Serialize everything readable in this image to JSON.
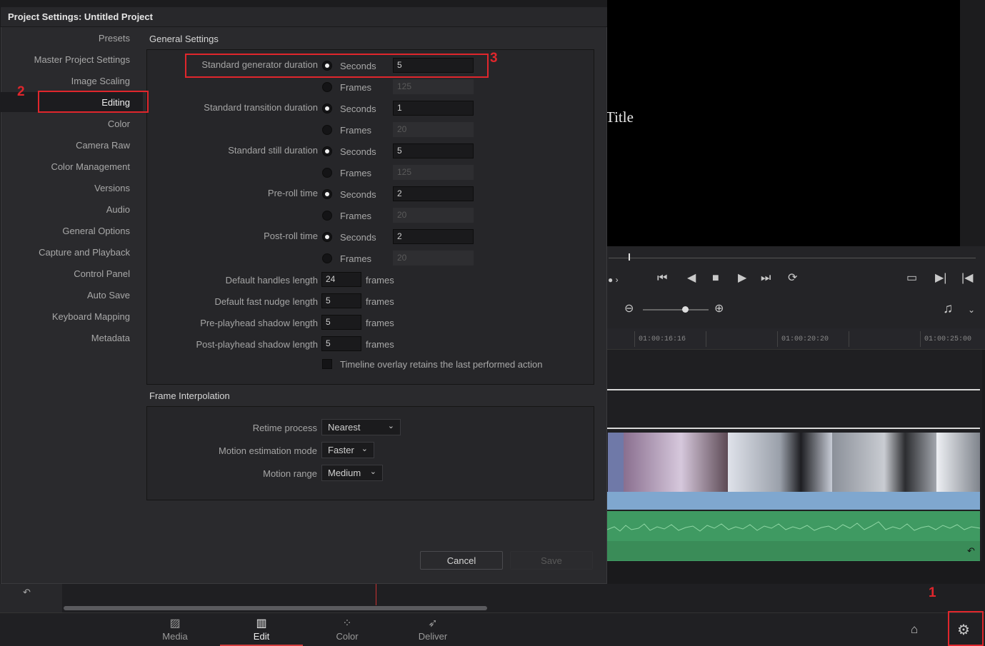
{
  "dialog": {
    "title": "Project Settings:  Untitled Project",
    "nav": [
      "Presets",
      "Master Project Settings",
      "Image Scaling",
      "Editing",
      "Color",
      "Camera Raw",
      "Color Management",
      "Versions",
      "Audio",
      "General Options",
      "Capture and Playback",
      "Control Panel",
      "Auto Save",
      "Keyboard Mapping",
      "Metadata"
    ],
    "active_nav": "Editing",
    "general": {
      "title": "General Settings",
      "rows": [
        {
          "label": "Standard generator duration",
          "seconds_label": "Seconds",
          "seconds": "5",
          "frames_label": "Frames",
          "frames": "125"
        },
        {
          "label": "Standard transition duration",
          "seconds_label": "Seconds",
          "seconds": "1",
          "frames_label": "Frames",
          "frames": "20"
        },
        {
          "label": "Standard still duration",
          "seconds_label": "Seconds",
          "seconds": "5",
          "frames_label": "Frames",
          "frames": "125"
        },
        {
          "label": "Pre-roll time",
          "seconds_label": "Seconds",
          "seconds": "2",
          "frames_label": "Frames",
          "frames": "20"
        },
        {
          "label": "Post-roll time",
          "seconds_label": "Seconds",
          "seconds": "2",
          "frames_label": "Frames",
          "frames": "20"
        }
      ],
      "lengths": [
        {
          "label": "Default handles length",
          "value": "24",
          "unit": "frames"
        },
        {
          "label": "Default fast nudge length",
          "value": "5",
          "unit": "frames"
        },
        {
          "label": "Pre-playhead shadow length",
          "value": "5",
          "unit": "frames"
        },
        {
          "label": "Post-playhead shadow length",
          "value": "5",
          "unit": "frames"
        }
      ],
      "overlay_checkbox": "Timeline overlay retains the last performed action"
    },
    "interpolation": {
      "title": "Frame Interpolation",
      "retime_label": "Retime process",
      "retime_value": "Nearest",
      "motion_est_label": "Motion estimation mode",
      "motion_est_value": "Faster",
      "motion_range_label": "Motion range",
      "motion_range_value": "Medium"
    },
    "cancel": "Cancel",
    "save": "Save"
  },
  "viewer": {
    "title_text": "Title"
  },
  "timeline": {
    "timecodes": [
      "01:00:16:16",
      "01:00:20:20",
      "01:00:25:00"
    ]
  },
  "pages": {
    "media": "Media",
    "edit": "Edit",
    "color": "Color",
    "deliver": "Deliver"
  },
  "annotations": {
    "one": "1",
    "two": "2",
    "three": "3"
  },
  "colors": {
    "annotation_red": "#e0262c",
    "active_tab_red": "#d23c3c",
    "audio_green": "#3f9a62",
    "video_blue": "#7fa7cf"
  }
}
